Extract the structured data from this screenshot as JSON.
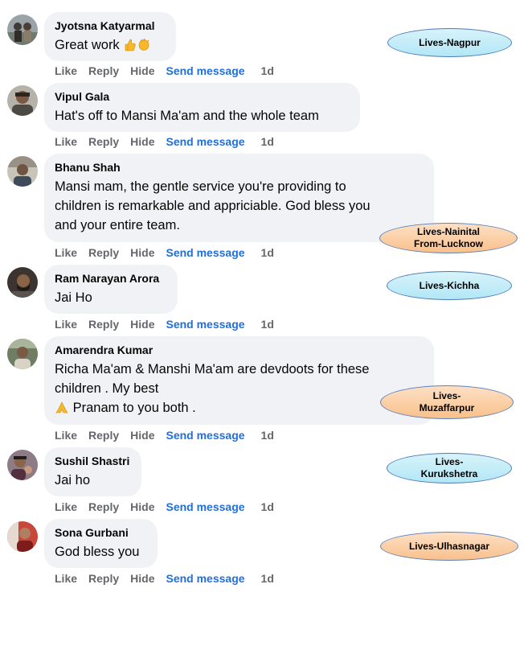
{
  "actions": {
    "like": "Like",
    "reply": "Reply",
    "hide": "Hide",
    "send": "Send message"
  },
  "comments": [
    {
      "name": "Jyotsna Katyarmal",
      "text": "Great work",
      "time": "1d",
      "tag": "Lives-Nagpur"
    },
    {
      "name": "Vipul Gala",
      "text": "Hat's off to Mansi Ma'am and the whole team",
      "time": "1d"
    },
    {
      "name": "Bhanu Shah",
      "lines": [
        "Mansi mam, the gentle service you're providing to",
        "children is remarkable and appriciable. God bless you",
        "and your entire team."
      ],
      "time": "1d",
      "tag": [
        "Lives-Nainital",
        "From-Lucknow"
      ]
    },
    {
      "name": "Ram Narayan Arora",
      "text": "Jai Ho",
      "time": "1d",
      "tag": "Lives-Kichha"
    },
    {
      "name": "Amarendra Kumar",
      "lines": [
        "Richa Ma'am & Manshi Ma'am are devdoots for these",
        "children . My best",
        "Pranam to you both ."
      ],
      "time": "1d",
      "tag": [
        "Lives-",
        "Muzaffarpur"
      ]
    },
    {
      "name": "Sushil Shastri",
      "text": "Jai ho",
      "time": "1d",
      "tag": [
        "Lives-",
        "Kurukshetra"
      ]
    },
    {
      "name": "Sona Gurbani",
      "text": "God bless you",
      "time": "1d",
      "tag": "Lives-Ulhasnagar"
    }
  ],
  "colors": {
    "bubble": "#f0f2f5",
    "link": "#216fdb",
    "muted": "#65676b",
    "tag_blue": "#c6ecf8",
    "tag_orange": "#fbcb9d"
  }
}
